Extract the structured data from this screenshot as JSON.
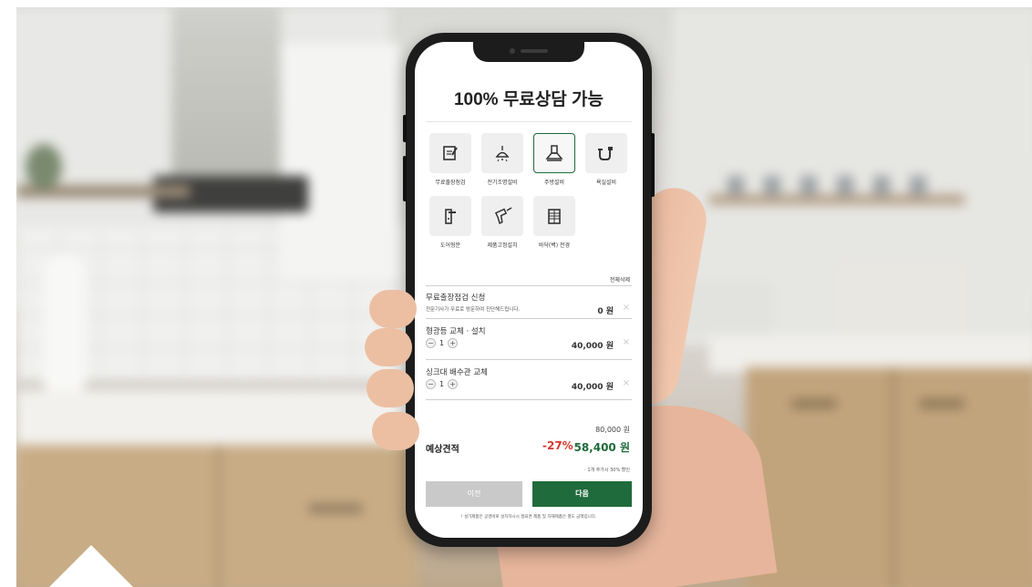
{
  "screen": {
    "title": "100% 무료상담 가능",
    "accent_color": "#1f6b3b",
    "discount_color": "#d9362c"
  },
  "services": [
    {
      "label": "무료출장점검",
      "icon": "checklist-icon",
      "active": false
    },
    {
      "label": "전기조명설비",
      "icon": "ceiling-lamp-icon",
      "active": false
    },
    {
      "label": "주방설비",
      "icon": "range-hood-icon",
      "active": true
    },
    {
      "label": "욕실설비",
      "icon": "plumbing-pipe-icon",
      "active": false
    },
    {
      "label": "도어형문",
      "icon": "door-handle-icon",
      "active": false
    },
    {
      "label": "제품고정설치",
      "icon": "drill-icon",
      "active": false
    },
    {
      "label": "바닥(벽) 전경",
      "icon": "floor-tile-icon",
      "active": false
    }
  ],
  "cart": {
    "delete_all": "전체삭제",
    "items": [
      {
        "title": "무료출장점검 신청",
        "desc": "전문기사가 무료로 방문하여 진단해드립니다.",
        "price": "0 원"
      },
      {
        "title": "형광등 교체 · 설치",
        "qty": "1",
        "price": "40,000 원"
      },
      {
        "title": "싱크대 배수관 교체",
        "qty": "1",
        "price": "40,000 원"
      }
    ],
    "remove_symbol": "×",
    "minus_symbol": "−",
    "plus_symbol": "+"
  },
  "summary": {
    "original_price": "80,000 원",
    "label": "예상견적",
    "discount": "-27%",
    "final_price": "58,400 원",
    "note": "· 1개 추가시 30% 할인"
  },
  "buttons": {
    "prev": "이전",
    "next": "다음"
  },
  "footer_note": "! 설가제품은 공영바로 설치하시시 절되면 제품 및 자재제품은 별도 금액입니다."
}
